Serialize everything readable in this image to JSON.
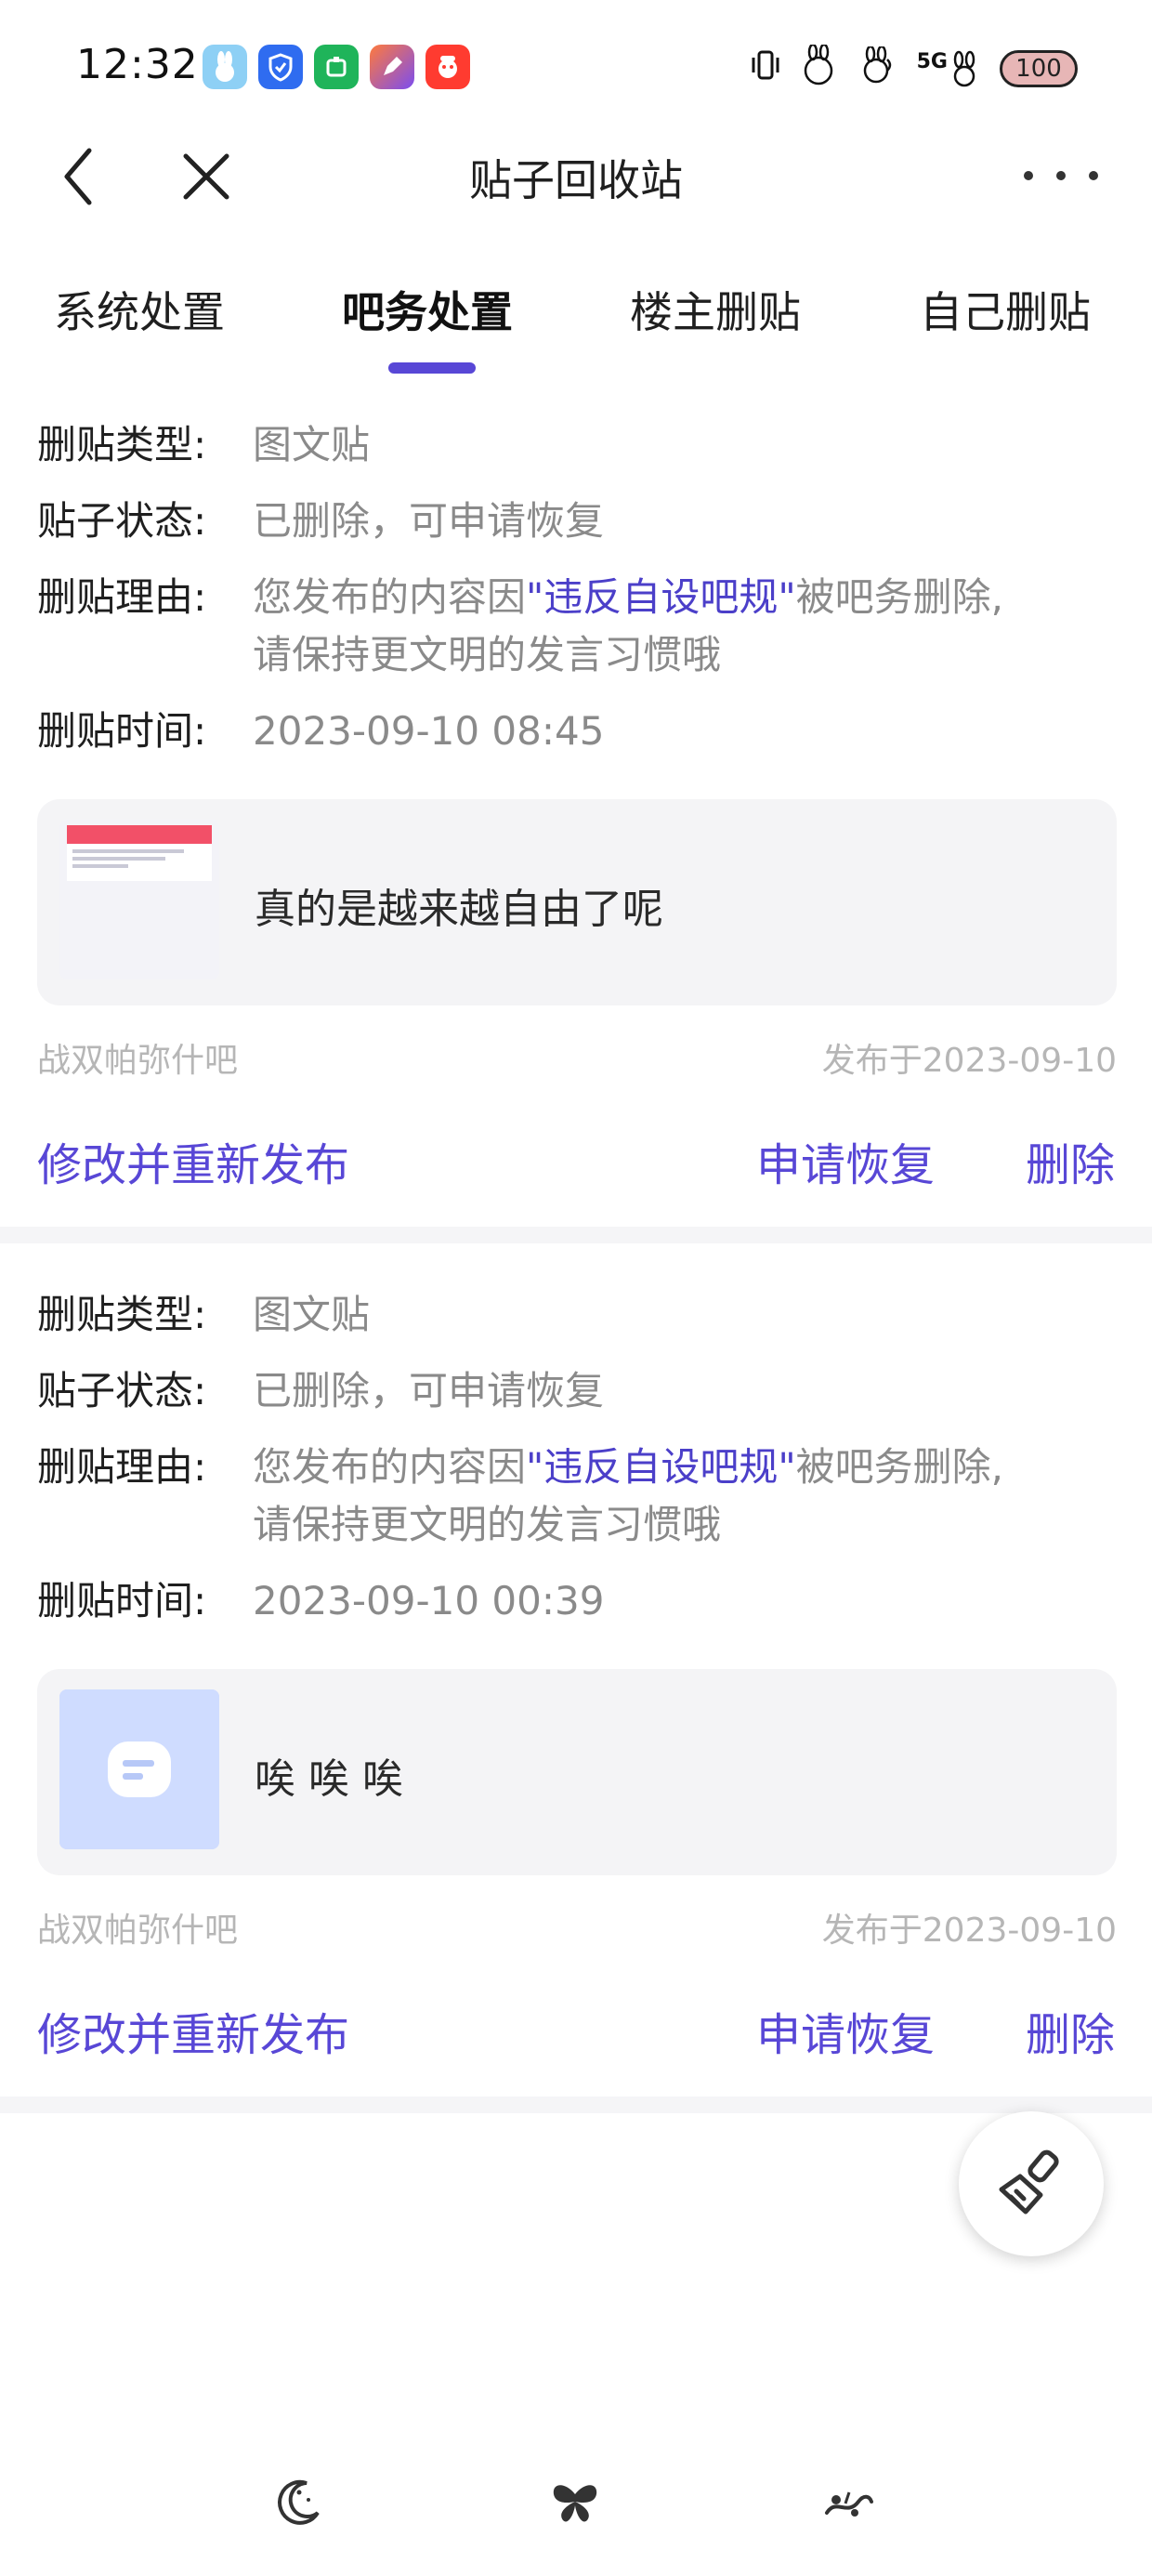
{
  "status_bar": {
    "time": "12:32",
    "battery": "100",
    "network": "5G",
    "app_icons": [
      "rabbit-app-icon",
      "shield-app-icon",
      "green-app-icon",
      "pen-app-icon",
      "red-app-icon"
    ],
    "system_icons": [
      "vibrate-icon",
      "hd-icon",
      "wifi-icon",
      "signal-icon",
      "battery-icon"
    ]
  },
  "nav": {
    "title": "贴子回收站",
    "back_icon": "back-chevron-icon",
    "close_icon": "close-icon",
    "more_icon": "more-dots-icon"
  },
  "tabs": [
    {
      "label": "系统处置",
      "active": false
    },
    {
      "label": "吧务处置",
      "active": true
    },
    {
      "label": "楼主删贴",
      "active": false
    },
    {
      "label": "自己删贴",
      "active": false
    }
  ],
  "labels": {
    "type": "删贴类型:",
    "status": "贴子状态:",
    "reason": "删贴理由:",
    "time": "删贴时间:"
  },
  "posts": [
    {
      "type": "图文贴",
      "status": "已删除，可申请恢复",
      "reason_prefix": "您发布的内容因",
      "reason_rule": "\"违反自设吧规\"",
      "reason_suffix": "被吧务删除,",
      "reason_line2": "请保持更文明的发言习惯哦",
      "time": "2023-09-10 08:45",
      "preview_text": "真的是越来越自由了呢",
      "thumbnail": "screenshot-thumbnail",
      "forum": "战双帕弥什吧",
      "published": "发布于2023-09-10",
      "actions": {
        "edit": "修改并重新发布",
        "restore": "申请恢复",
        "delete": "删除"
      }
    },
    {
      "type": "图文贴",
      "status": "已删除，可申请恢复",
      "reason_prefix": "您发布的内容因",
      "reason_rule": "\"违反自设吧规\"",
      "reason_suffix": "被吧务删除,",
      "reason_line2": "请保持更文明的发言习惯哦",
      "time": "2023-09-10 00:39",
      "preview_text": "唉 唉 唉",
      "thumbnail": "placeholder-image-icon",
      "forum": "战双帕弥什吧",
      "published": "发布于2023-09-10",
      "actions": {
        "edit": "修改并重新发布",
        "restore": "申请恢复",
        "delete": "删除"
      }
    }
  ],
  "fab": {
    "icon": "broom-clean-icon"
  },
  "bottom_nav": [
    "moon-icon",
    "butterfly-icon",
    "vine-icon"
  ],
  "colors": {
    "accent": "#5847d6",
    "highlight": "#4b3fc9",
    "muted": "#8a8a8a",
    "meta": "#b6b6b6",
    "card_bg": "#f4f4f6"
  }
}
